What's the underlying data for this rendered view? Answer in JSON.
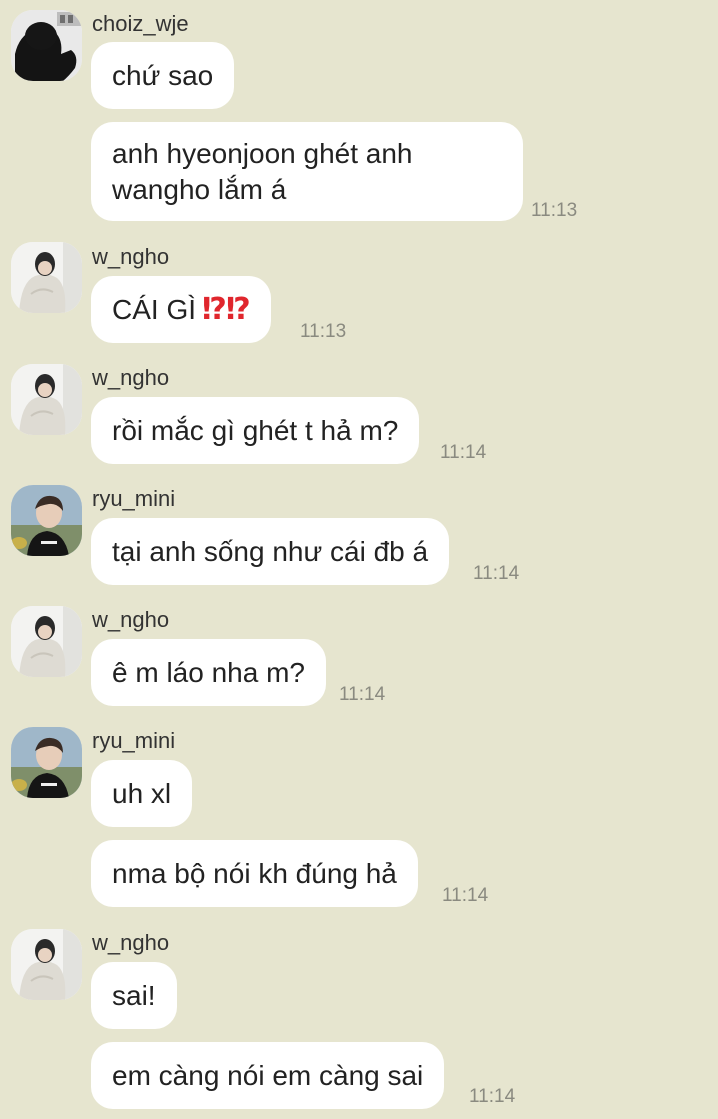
{
  "colors": {
    "background": "#e6e5cf",
    "bubble": "#ffffff",
    "text": "#222222",
    "sender_name": "#333333",
    "timestamp": "#8a8a80",
    "emoji_red": "#e0262d"
  },
  "groups": [
    {
      "sender": "choiz_wje",
      "avatar_icon": "dark-silhouette-avatar-icon",
      "messages": [
        {
          "text": "chứ sao"
        },
        {
          "text": "anh hyeonjoon ghét anh wangho lắm á",
          "time": "11:13"
        }
      ]
    },
    {
      "sender": "w_ngho",
      "avatar_icon": "person-white-sweater-avatar-icon",
      "messages": [
        {
          "text": "CÁI GÌ",
          "emoji": "⁉⁉",
          "emoji_icon": "red-exclamation-question-icon",
          "time": "11:13"
        }
      ]
    },
    {
      "sender": "w_ngho",
      "avatar_icon": "person-white-sweater-avatar-icon",
      "messages": [
        {
          "text": "rồi mắc gì ghét t hả m?",
          "time": "11:14"
        }
      ]
    },
    {
      "sender": "ryu_mini",
      "avatar_icon": "person-black-tshirt-avatar-icon",
      "messages": [
        {
          "text": "tại anh sống như cái đb á",
          "time": "11:14"
        }
      ]
    },
    {
      "sender": "w_ngho",
      "avatar_icon": "person-white-sweater-avatar-icon",
      "messages": [
        {
          "text": "ê m láo nha m?",
          "time": "11:14"
        }
      ]
    },
    {
      "sender": "ryu_mini",
      "avatar_icon": "person-black-tshirt-avatar-icon",
      "messages": [
        {
          "text": "uh xl"
        },
        {
          "text": "nma bộ nói kh đúng hả",
          "time": "11:14"
        }
      ]
    },
    {
      "sender": "w_ngho",
      "avatar_icon": "person-white-sweater-avatar-icon",
      "messages": [
        {
          "text": "sai!"
        },
        {
          "text": "em càng nói em càng sai",
          "time": "11:14"
        }
      ]
    }
  ]
}
